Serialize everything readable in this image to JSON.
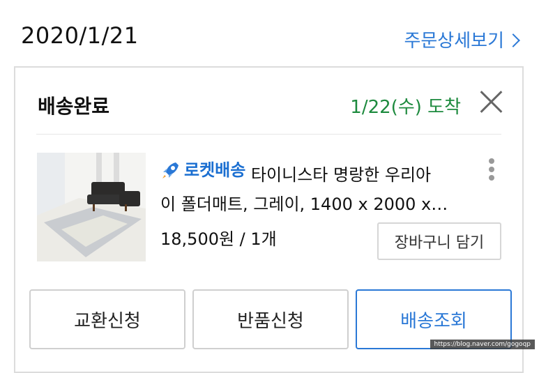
{
  "order": {
    "date": "2020/1/21",
    "detail_link": "주문상세보기"
  },
  "shipment": {
    "status": "배송완료",
    "arrival": "1/22(수) 도착"
  },
  "product": {
    "badge": "로켓배송",
    "title_line1": "타이니스타 명랑한 우리아",
    "title_line2": "이 폴더매트, 그레이, 1400 x 2000 x…",
    "price_qty": "18,500원 / 1개",
    "cart_button": "장바구니 담기"
  },
  "actions": {
    "exchange": "교환신청",
    "return": "반품신청",
    "tracking": "배송조회"
  },
  "watermark": "https://blog.naver.com/gogoqp",
  "colors": {
    "accent_blue": "#2a78d6",
    "arrival_green": "#1d8a3e"
  },
  "icons": [
    "chevron-right-icon",
    "close-icon",
    "rocket-icon",
    "more-vertical-icon"
  ]
}
